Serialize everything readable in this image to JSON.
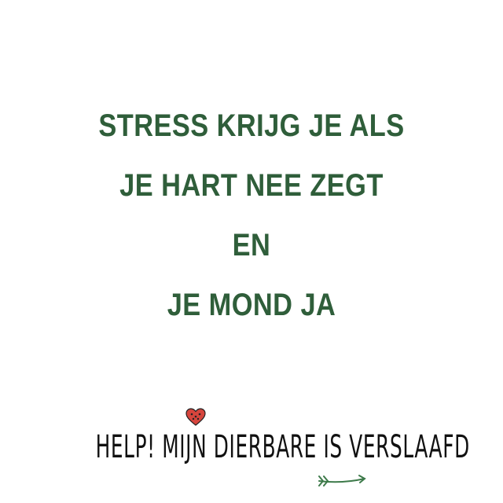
{
  "quote": {
    "lines": [
      "STRESS KRIJG JE ALS",
      "JE HART NEE ZEGT",
      "EN",
      "JE MOND JA"
    ]
  },
  "brand": {
    "text": "HELP! MIJN DIERBARE IS VERSLAAFD"
  },
  "icons": {
    "heart": "heart-icon",
    "arrow": "arrow-icon"
  },
  "colors": {
    "quote_green": "#2f5e3a",
    "brand_black": "#111111",
    "heart_red": "#d6453d",
    "arrow_green": "#3d7a4a"
  }
}
